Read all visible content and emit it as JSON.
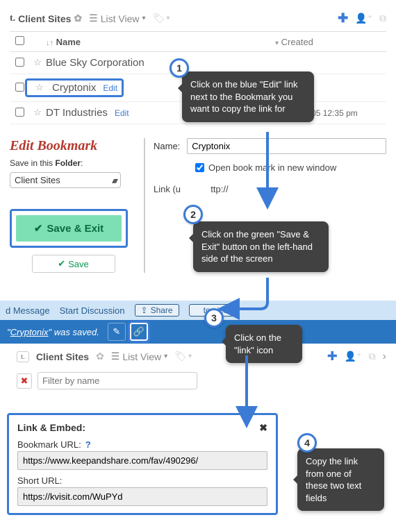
{
  "panel1": {
    "folder_icon_label": "t.",
    "folder_name": "Client Sites",
    "view_label": "List View",
    "name_header": "Name",
    "created_header": "Created",
    "rows": [
      {
        "name": "Blue Sky Corporation",
        "edit": null
      },
      {
        "name": "Cryptonix",
        "edit": "Edit"
      },
      {
        "name": "DT Industries",
        "edit": "Edit",
        "created": "Jul 21, 2005 12:35 pm"
      }
    ]
  },
  "panel2": {
    "title": "Edit Bookmark",
    "save_in_label": "Save in this Folder:",
    "folder_value": "Client Sites",
    "save_exit_label": "Save & Exit",
    "save_label": "Save",
    "name_label": "Name:",
    "name_value": "Cryptonix",
    "open_new_label": "Open book mark in new window",
    "link_label_partial": "Link (u",
    "link_suffix": "ttp://"
  },
  "panel3": {
    "msg": "d Message",
    "discussion": "Start Discussion",
    "share": "Share",
    "customize_suffix": "tomize",
    "saved_prefix": "\"",
    "saved_name": "Cryptonix",
    "saved_suffix": "\" was saved.",
    "folder_prefix": "t.",
    "folder_name": "Client Sites",
    "view_label": "List View",
    "filter_placeholder": "Filter by name"
  },
  "panel4": {
    "title": "Link & Embed:",
    "bookmark_label": "Bookmark URL:",
    "bookmark_value": "https://www.keepandshare.com/fav/490296/",
    "short_label": "Short URL:",
    "short_value": "https://kvisit.com/WuPYd"
  },
  "tips": {
    "t1": "Click on the blue \"Edit\" link next to the Bookmark you want to copy the link for",
    "t2": "Click on the green \"Save & Exit\" button on the left-hand side of the screen",
    "t3": "Click on the \"link\" icon",
    "t4": "Copy the link from one of these two text fields"
  },
  "nums": {
    "n1": "1",
    "n2": "2",
    "n3": "3",
    "n4": "4"
  }
}
